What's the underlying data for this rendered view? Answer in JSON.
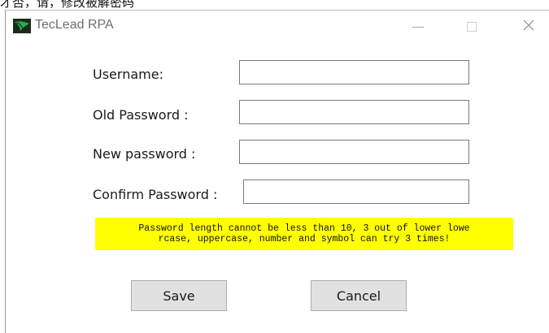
{
  "fragment_text": "才否，请，修改被解密码",
  "window": {
    "title": "TecLead RPA",
    "controls": {
      "minimize": "—",
      "close": "✕"
    }
  },
  "form": {
    "username": {
      "label": "Username:",
      "value": ""
    },
    "old_password": {
      "label": "Old Password :",
      "value": ""
    },
    "new_password": {
      "label": "New password :",
      "value": ""
    },
    "confirm_password": {
      "label": "Confirm Password :",
      "value": ""
    }
  },
  "notice": {
    "line1": "Password length cannot be less than 10, 3 out of lower lowe",
    "line2": "rcase, uppercase, number and symbol can try 3 times!",
    "background": "#ffff00"
  },
  "buttons": {
    "save": "Save",
    "cancel": "Cancel"
  },
  "icons": {
    "app": "leaf-logo-icon"
  },
  "colors": {
    "logo_green": "#1a9a2e",
    "logo_dark": "#1a2a1a"
  }
}
